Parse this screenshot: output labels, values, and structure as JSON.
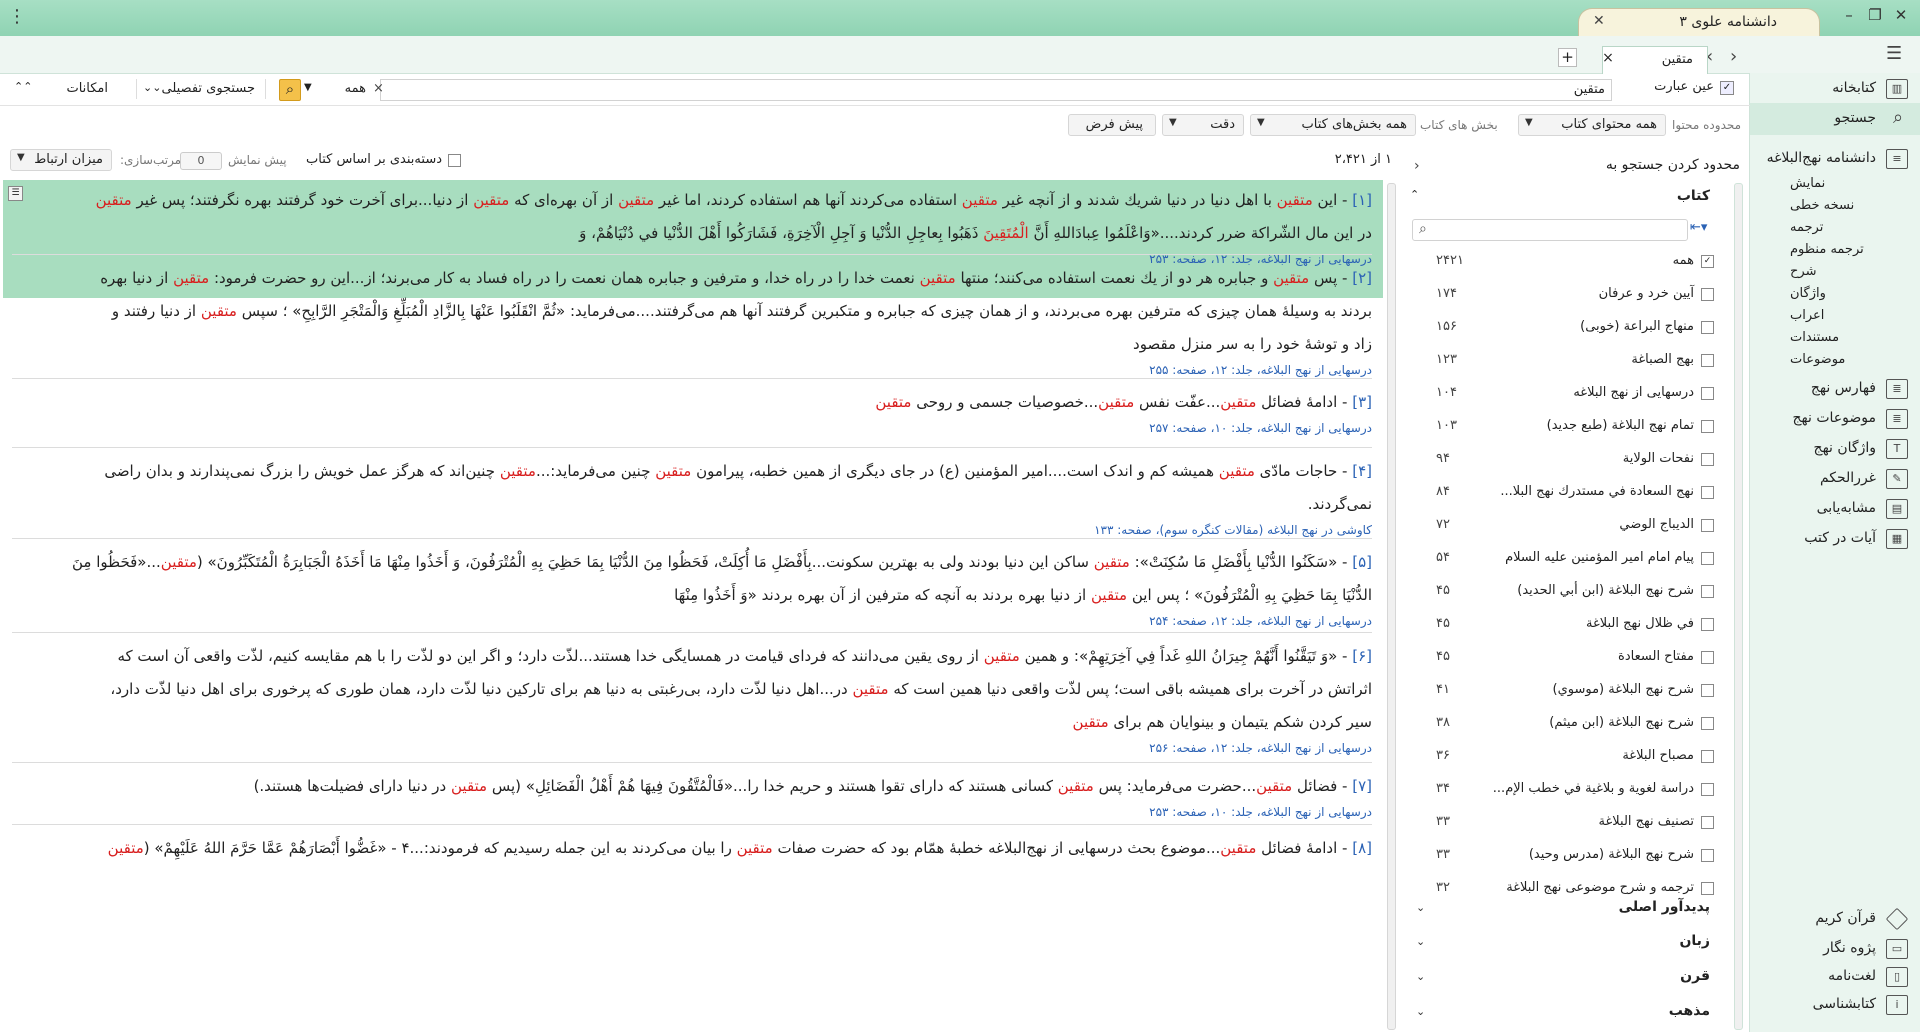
{
  "app": {
    "title": "دانشنامه علوی ۳",
    "new_tab": "+",
    "menu_glyph": "⋮"
  },
  "doc_tab": {
    "label": "متقین",
    "close": "×",
    "add": "+",
    "back": "‹",
    "forward": "›"
  },
  "window_controls": {
    "minimize": "–",
    "restore": "❐",
    "close": "✕"
  },
  "sidebar": {
    "items": [
      {
        "label": "کتابخانه"
      },
      {
        "label": "جستجو"
      },
      {
        "label": "دانشنامه نهج‌البلاغه"
      },
      {
        "label": "فهارس نهج"
      },
      {
        "label": "موضوعات نهج"
      },
      {
        "label": "واژگان نهج"
      },
      {
        "label": "غررالحکم"
      },
      {
        "label": "مشابه‌یابی"
      },
      {
        "label": "آیات در کتب"
      }
    ],
    "subitems": [
      "نمایش",
      "نسخه خطی",
      "ترجمه",
      "ترجمه منظوم",
      "شرح",
      "واژگان",
      "اعراب",
      "مستندات",
      "موضوعات"
    ],
    "bottom": [
      {
        "label": "قرآن کریم"
      },
      {
        "label": "پژوه نگار"
      },
      {
        "label": "لغت‌نامه"
      },
      {
        "label": "کتابشناسی"
      }
    ]
  },
  "search": {
    "exact_label": "عین عبارت",
    "query": "متقین",
    "scope_value": "همه",
    "detailed": "جستجوی تفصیلی",
    "options": "امکانات",
    "content_scope_label": "محدوده محتوا",
    "content_scope_value": "همه محتوای کتاب",
    "book_sections_label": "بخش های کتاب",
    "book_sections_value": "همه بخش‌های کتاب",
    "precision": "دقت",
    "default": "پیش فرض",
    "clear": "×"
  },
  "results_bar": {
    "count": "۱ از ۲،۴۲۱",
    "group_by_book": "دسته‌بندی بر اساس کتاب",
    "preview": "پیش نمایش",
    "preview_value": "0",
    "sort_label": "مرتب‌سازی:",
    "sort_value": "میزان ارتباط"
  },
  "filter": {
    "title": "محدود کردن جستجو به",
    "books_header": "کتاب",
    "books": [
      {
        "name": "همه",
        "count": "۲۴۲۱",
        "checked": true
      },
      {
        "name": "آیین خرد و عرفان",
        "count": "۱۷۴"
      },
      {
        "name": "منهاج البراعة (خوبی)",
        "count": "۱۵۶"
      },
      {
        "name": "بهج الصباغة",
        "count": "۱۲۳"
      },
      {
        "name": "درسهایی از نهج البلاغه",
        "count": "۱۰۴"
      },
      {
        "name": "تمام نهج البلاغة (طبع جدید)",
        "count": "۱۰۳"
      },
      {
        "name": "نفحات الولایة",
        "count": "۹۴"
      },
      {
        "name": "نهج السعادة في مستدرك نهج البلا...",
        "count": "۸۴"
      },
      {
        "name": "الدیباج الوضي",
        "count": "۷۲"
      },
      {
        "name": "پیام امام امیر المؤمنین علیه السلام",
        "count": "۵۴"
      },
      {
        "name": "شرح نهج البلاغة (ابن أبي الحدید)",
        "count": "۴۵"
      },
      {
        "name": "في ظلال نهج البلاغة",
        "count": "۴۵"
      },
      {
        "name": "مفتاح السعادة",
        "count": "۴۵"
      },
      {
        "name": "شرح نهج البلاغة (موسوي)",
        "count": "۴۱"
      },
      {
        "name": "شرح نهج البلاغة (ابن میثم)",
        "count": "۳۸"
      },
      {
        "name": "مصباح البلاغة",
        "count": "۳۶"
      },
      {
        "name": "دراسة لغوية و بلاغية في خطب الإم...",
        "count": "۳۴"
      },
      {
        "name": "تصنیف نهج البلاغة",
        "count": "۳۳"
      },
      {
        "name": "شرح نهج البلاغة (مدرس وحید)",
        "count": "۳۳"
      },
      {
        "name": "ترجمه و شرح موضوعی نهج البلاغة",
        "count": "۳۲"
      }
    ],
    "facets": [
      "پدیدآور اصلی",
      "زبان",
      "قرن",
      "مذهب"
    ]
  },
  "results": [
    {
      "num": "[۱]",
      "lines": [
        [
          [
            "- این ",
            0
          ],
          [
            "متقین",
            1
          ],
          [
            " با اهل دنیا در دنیا شريك شدند و از آنچه غير ",
            0
          ],
          [
            "متقين",
            1
          ],
          [
            " استفاده مى‌كردند آنها هم استفاده كردند، اما غير ",
            0
          ],
          [
            "متقين",
            1
          ],
          [
            " از آن بهره‌ای كه ",
            0
          ],
          [
            "متقين",
            1
          ],
          [
            " از دنیا...برای آخرت خود گرفتند بهره نگرفتند؛ پس غیر ",
            0
          ],
          [
            "متقین",
            1
          ]
        ],
        [
          [
            "در این مال الشّراكة ضرر كردند....«وَاعْلَمُوا عِبادَاللهِ أَنَّ ",
            0
          ],
          [
            "الْمُتَقِينَ",
            1
          ],
          [
            " ذَهَبُوا بِعاجِلِ الدُّنْيا وَ آجِلِ الْآخِرَةِ، فَشَارَكُوا أَهْلَ الدُّنْيا في دُنْيَاهُمْ، وَ",
            0
          ]
        ]
      ],
      "source": "درسهایی از نهج البلاغه، جلد: ۱۲، صفحه: ۲۵۳"
    },
    {
      "num": "[۲]",
      "lines": [
        [
          [
            "- پس ",
            0
          ],
          [
            "متقين",
            1
          ],
          [
            " و جبابره هر دو از يك نعمت استفاده مى‌كنند؛ منتها ",
            0
          ],
          [
            "متقين",
            1
          ],
          [
            " نعمت خدا را در راه خدا، و مترفين و جبابره همان نعمت را در راه فساد به كار مى‌برند؛ از...این رو حضرت فرمود: ",
            0
          ],
          [
            "متقين",
            1
          ],
          [
            " از دنيا بهره",
            0
          ]
        ],
        [
          [
            "بردند به وسيلهٔ همان چيزى كه مترفين بهره مى‌بردند، و از همان چيزى كه جبابره و متكبرين گرفتند آنها هم مى‌گرفتند....مى‌فرمايد: «ثُمَّ انْقَلَبُوا عَنْهَا بِالزَّادِ الْمُبَلِّغِ وَالْمَتْجَرِ الرَّابِحِ» ؛ سپس ",
            0
          ],
          [
            "متقين",
            1
          ],
          [
            " از دنيا رفتند و",
            0
          ]
        ],
        [
          [
            "زاد و توشهٔ خود را به سر منزل مقصود",
            0
          ]
        ]
      ],
      "source": "درسهایی از نهج البلاغه، جلد: ۱۲، صفحه: ۲۵۵"
    },
    {
      "num": "[۳]",
      "lines": [
        [
          [
            "- ادامهٔ فضائل ",
            0
          ],
          [
            "متقین",
            1
          ],
          [
            "...عفّت نفس ",
            0
          ],
          [
            "متقین",
            1
          ],
          [
            "...خصوصیات جسمی و روحی ",
            0
          ],
          [
            "متقین",
            1
          ]
        ]
      ],
      "source": "درسهایی از نهج البلاغه، جلد: ۱۰، صفحه: ۲۵۷"
    },
    {
      "num": "[۴]",
      "lines": [
        [
          [
            "- حاجات مادّی ",
            0
          ],
          [
            "متقین",
            1
          ],
          [
            " همیشه کم و اندک است....امیر المؤمنین (ع) در جای دیگری از همین خطبه، پیرامون ",
            0
          ],
          [
            "متقین",
            1
          ],
          [
            " چنین می‌فرماید:...",
            0
          ],
          [
            "متقین",
            1
          ],
          [
            " چنین‌اند که هرگز عمل خویش را بزرگ نمی‌پندارند و بدان راضی",
            0
          ]
        ],
        [
          [
            "نمی‌گردند.",
            0
          ]
        ]
      ],
      "source": "کاوشی در نهج البلاغه (مقالات کنگره سوم)، صفحه: ۱۳۳"
    },
    {
      "num": "[۵]",
      "lines": [
        [
          [
            "- «سَكَنُوا الدُّنْيا بِأَفْضَلِ مَا سُكِنَتْ»: ",
            0
          ],
          [
            "متقين",
            1
          ],
          [
            " ساكن اين دنيا بودند ولى به بهترين سكونت...بِأَفْضَلِ مَا أُكِلَتْ، فَحَظُوا مِنَ الدُّنْيَا بِمَا حَظِيَ بِهِ الْمُتْرَفُونَ، وَ أَخَذُوا مِنْهَا مَا أَخَذَهُ الْجَبَابِرَةُ الْمُتَكَبِّرُونَ» (",
            0
          ],
          [
            "متقين",
            1
          ],
          [
            "...«فَحَظُوا مِنَ",
            0
          ]
        ],
        [
          [
            "الدُّنْيَا بِمَا حَظِيَ بِهِ الْمُتْرَفُونَ» ؛ پس اين ",
            0
          ],
          [
            "متقين",
            1
          ],
          [
            " از دنيا بهره بردند به آنچه كه مترفين از آن بهره بردند «وَ أَخَذُوا مِنْهَا",
            0
          ]
        ]
      ],
      "source": "درسهایی از نهج البلاغه، جلد: ۱۲، صفحه: ۲۵۴"
    },
    {
      "num": "[۶]",
      "lines": [
        [
          [
            "- «وَ تَيَقَّنُوا أَنَّهُمْ جِيرَانُ اللهِ غَداً فِي آخِرَتِهِمْ»: و همین ",
            0
          ],
          [
            "متقین",
            1
          ],
          [
            " از روی یقین می‌دانند که فردای قیامت در همسایگی خدا هستند...لذّت دارد؛ و اگر این دو لذّت را با هم مقایسه کنیم، لذّت واقعی آن است که",
            0
          ]
        ],
        [
          [
            "اثراتش در آخرت برای همیشه باقی است؛ پس لذّت واقعی دنیا همین است که ",
            0
          ],
          [
            "متقين",
            1
          ],
          [
            " در...اهل دنیا لذّت دارد، بی‌رغبتی به دنیا هم برای تارکین دنیا لذّت دارد، همان طوری که پرخوری برای اهل دنیا لذّت دارد،",
            0
          ]
        ],
        [
          [
            "سیر کردن شکم یتیمان و بینوایان هم برای ",
            0
          ],
          [
            "متقین",
            1
          ]
        ]
      ],
      "source": "درسهایی از نهج البلاغه، جلد: ۱۲، صفحه: ۲۵۶"
    },
    {
      "num": "[۷]",
      "lines": [
        [
          [
            "- فضائل ",
            0
          ],
          [
            "متقین",
            1
          ],
          [
            "...حضرت می‌فرماید: پس ",
            0
          ],
          [
            "متقین",
            1
          ],
          [
            " کسانی هستند که دارای تقوا هستند و حریم خدا را...«فَالْمُتَّقُونَ فِيهَا هُمْ أَهْلُ الْفَضَائِلِ» (پس ",
            0
          ],
          [
            "متقین",
            1
          ],
          [
            " در دنیا دارای فضیلت‌ها هستند.)",
            0
          ]
        ]
      ],
      "source": "درسهایی از نهج البلاغه، جلد: ۱۰، صفحه: ۲۵۳"
    },
    {
      "num": "[۸]",
      "lines": [
        [
          [
            "- ادامهٔ فضائل ",
            0
          ],
          [
            "متقين",
            1
          ],
          [
            "...موضوع بحث درسهایی از نهج‌البلاغه خطبهٔ همّام بود که حضرت صفات ",
            0
          ],
          [
            "متقين",
            1
          ],
          [
            " را بیان می‌کردند به این جمله رسیدیم که فرمودند:...۴ - «غَضُّوا أَبْصَارَهُمْ عَمَّا حَرَّمَ اللهُ عَلَيْهِمْ» (",
            0
          ],
          [
            "متقين",
            1
          ]
        ]
      ],
      "source": ""
    }
  ]
}
